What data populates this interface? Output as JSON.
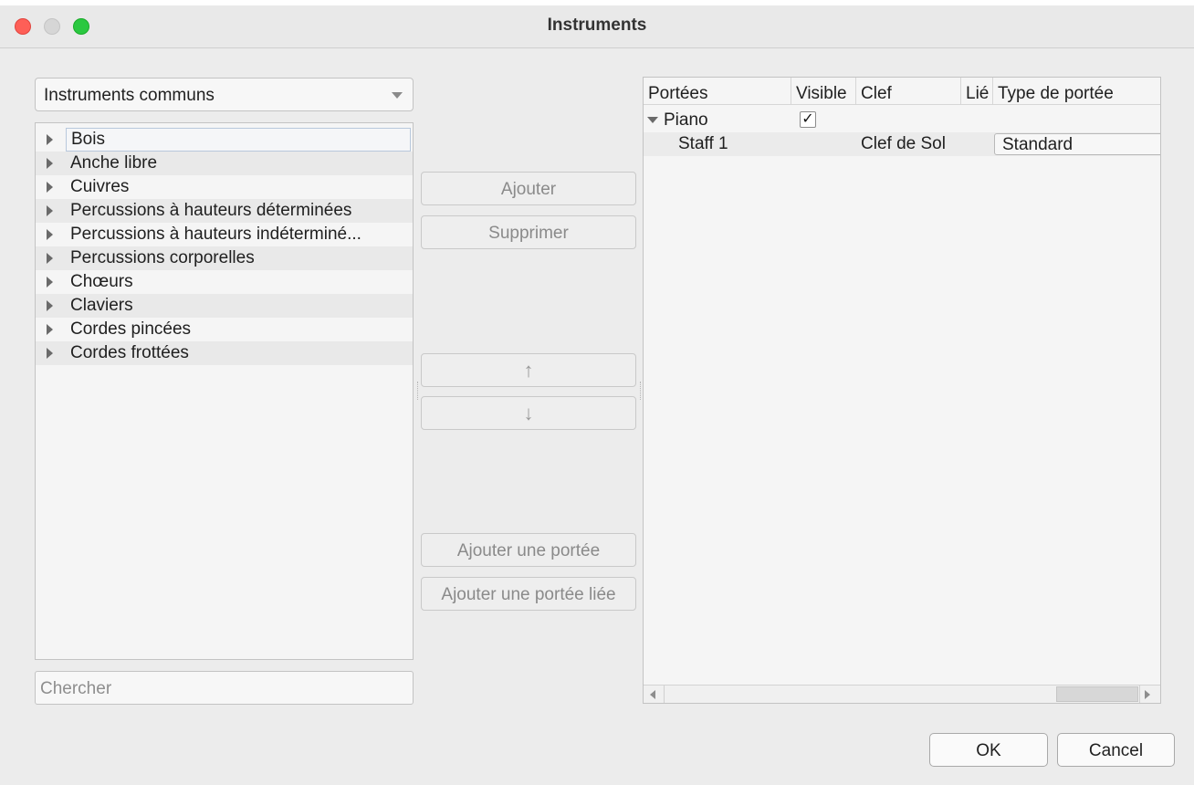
{
  "window": {
    "title": "Instruments"
  },
  "instrument_list": {
    "genre_select": "Instruments communs",
    "categories": [
      {
        "label": "Bois"
      },
      {
        "label": "Anche libre"
      },
      {
        "label": "Cuivres"
      },
      {
        "label": "Percussions à hauteurs déterminées"
      },
      {
        "label": "Percussions à hauteurs indéterminé..."
      },
      {
        "label": "Percussions corporelles"
      },
      {
        "label": "Chœurs"
      },
      {
        "label": "Claviers"
      },
      {
        "label": "Cordes pincées"
      },
      {
        "label": "Cordes frottées"
      }
    ],
    "search_placeholder": "Chercher"
  },
  "actions": {
    "add": "Ajouter",
    "remove": "Supprimer",
    "move_up": "↑",
    "move_down": "↓",
    "add_staff": "Ajouter une portée",
    "add_linked_staff": "Ajouter une portée liée"
  },
  "score_table": {
    "headers": [
      "Portées",
      "Visible",
      "Clef",
      "Lié",
      "Type de portée"
    ],
    "instrument": {
      "name": "Piano",
      "visible": true,
      "check_glyph": "✓"
    },
    "staff": {
      "name": "Staff 1",
      "clef": "Clef de Sol",
      "type": "Standard"
    }
  },
  "dialog": {
    "ok": "OK",
    "cancel": "Cancel"
  }
}
